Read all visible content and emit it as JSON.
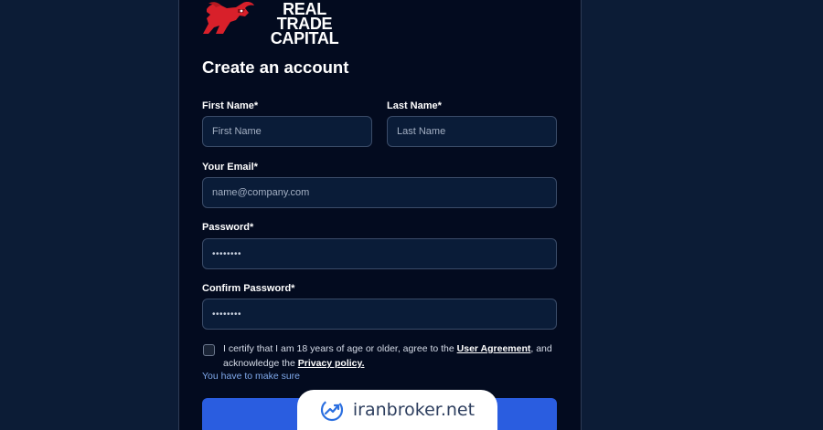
{
  "brand": {
    "line1": "REAL TRADE",
    "line2": "CAPITAL",
    "logo_icon": "bull-icon",
    "accent_color": "#d8202a"
  },
  "form": {
    "title": "Create an account",
    "first_name": {
      "label": "First Name*",
      "placeholder": "First Name"
    },
    "last_name": {
      "label": "Last Name*",
      "placeholder": "Last Name"
    },
    "email": {
      "label": "Your Email*",
      "placeholder": "name@company.com"
    },
    "password": {
      "label": "Password*",
      "value": "••••••••"
    },
    "confirm_password": {
      "label": "Confirm Password*",
      "value": "••••••••"
    },
    "consent": {
      "text_before": "I certify that I am 18 years of age or older, agree to the ",
      "user_agreement": "User Agreement",
      "text_middle": ", and acknowledge the ",
      "privacy_policy": "Privacy policy.",
      "checked": false
    },
    "helper_text": "You have to make sure",
    "submit_color": "#2a5de0"
  },
  "watermark": {
    "text": "iranbroker.net",
    "icon": "growth-chart-icon"
  },
  "colors": {
    "page_bg": "#0c1c36",
    "panel_bg": "#030b1f",
    "field_bg": "#0a1c38",
    "helper": "#7fa8ea"
  }
}
